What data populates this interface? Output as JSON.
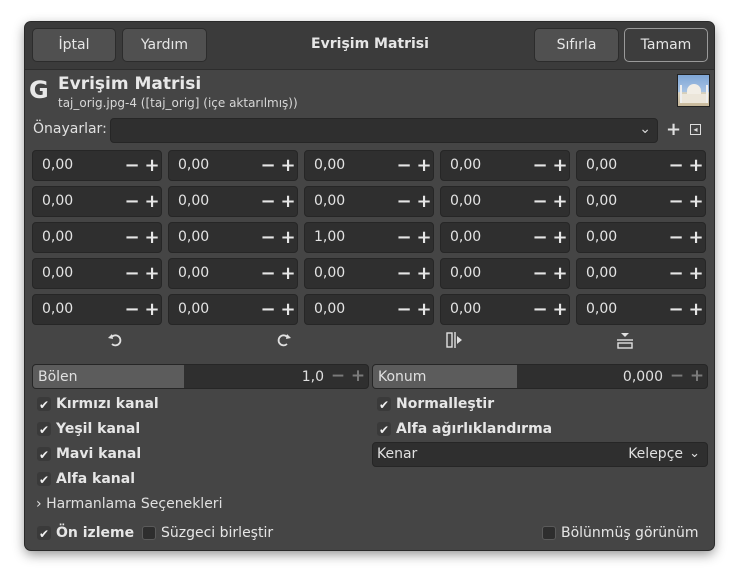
{
  "header": {
    "cancel_label": "İptal",
    "help_label": "Yardım",
    "title": "Evrişim Matrisi",
    "reset_label": "Sıfırla",
    "ok_label": "Tamam"
  },
  "plugin": {
    "logo_char": "G",
    "title": "Evrişim Matrisi",
    "subtitle": "taj_orig.jpg-4 ([taj_orig] (içe aktarılmış))",
    "thumbnail_icon": "taj-mahal-thumbnail"
  },
  "presets": {
    "label": "Önayarlar:",
    "value": "",
    "add_icon": "+",
    "menu_icon": "◂"
  },
  "matrix": {
    "rows": [
      [
        "0,00",
        "0,00",
        "0,00",
        "0,00",
        "0,00"
      ],
      [
        "0,00",
        "0,00",
        "0,00",
        "0,00",
        "0,00"
      ],
      [
        "0,00",
        "0,00",
        "1,00",
        "0,00",
        "0,00"
      ],
      [
        "0,00",
        "0,00",
        "0,00",
        "0,00",
        "0,00"
      ],
      [
        "0,00",
        "0,00",
        "0,00",
        "0,00",
        "0,00"
      ]
    ],
    "minus": "−",
    "plus": "+"
  },
  "transform_icons": [
    "rotate-left-icon",
    "rotate-right-icon",
    "flip-horizontal-icon",
    "flip-vertical-icon"
  ],
  "divisor": {
    "label": "Bölen",
    "value": "1,0",
    "fill_fraction": 0.45
  },
  "offset": {
    "label": "Konum",
    "value": "0,000",
    "fill_fraction": 0.43
  },
  "channels": {
    "red": {
      "label": "Kırmızı kanal",
      "checked": true
    },
    "green": {
      "label": "Yeşil kanal",
      "checked": true
    },
    "blue": {
      "label": "Mavi kanal",
      "checked": true
    },
    "alpha": {
      "label": "Alfa kanal",
      "checked": true
    }
  },
  "options": {
    "normalize": {
      "label": "Normalleştir",
      "checked": true
    },
    "alpha_weighting": {
      "label": "Alfa ağırlıklandırma",
      "checked": true
    }
  },
  "border": {
    "label": "Kenar",
    "value": "Kelepçe"
  },
  "blending": {
    "label": "Harmanlama Seçenekleri"
  },
  "footer": {
    "preview": {
      "label": "Ön izleme",
      "checked": true
    },
    "merge": {
      "label": "Süzgeci birleştir",
      "checked": false
    },
    "split": {
      "label": "Bölünmüş görünüm",
      "checked": false
    }
  }
}
